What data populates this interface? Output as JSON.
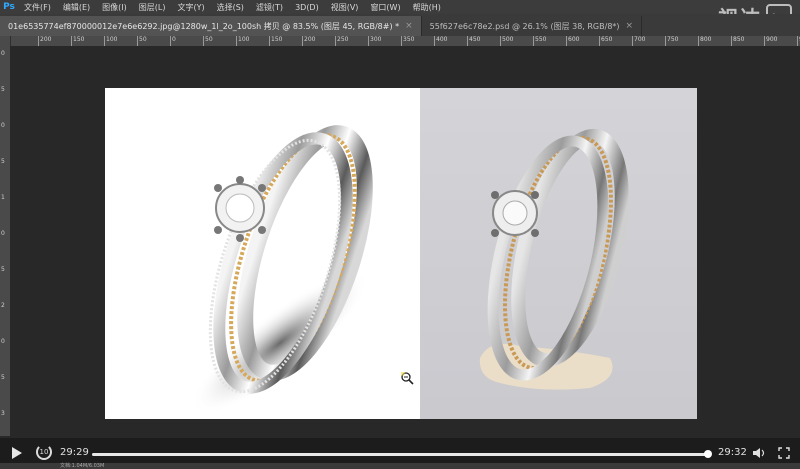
{
  "app": {
    "logo": "Ps"
  },
  "menu": [
    "文件(F)",
    "编辑(E)",
    "图像(I)",
    "图层(L)",
    "文字(Y)",
    "选择(S)",
    "滤镜(T)",
    "3D(D)",
    "视图(V)",
    "窗口(W)",
    "帮助(H)"
  ],
  "watermark": {
    "text": "视达",
    "icon": "play-icon"
  },
  "tabs": [
    {
      "label": "01e6535774ef870000012e7e6e6292.jpg@1280w_1l_2o_100sh 拷贝 @ 83.5% (图层 45, RGB/8#) *",
      "close": "×"
    },
    {
      "label": "55f627e6c78e2.psd @ 26.1% (图层 38, RGB/8*)",
      "close": "×"
    }
  ],
  "ruler": {
    "top_ticks": [
      "200",
      "150",
      "100",
      "50",
      "0",
      "50",
      "100",
      "150",
      "200",
      "250",
      "300",
      "350",
      "400",
      "450",
      "500",
      "550",
      "600",
      "650",
      "700",
      "750",
      "800",
      "850",
      "900",
      "950"
    ],
    "left_ticks": [
      "0",
      "5",
      "0",
      "5",
      "1",
      "0",
      "5",
      "2",
      "0",
      "5",
      "3"
    ]
  },
  "player": {
    "elapsed": "29:29",
    "total": "29:32",
    "progress": 0.998,
    "replay_label": "10"
  },
  "status": {
    "text": "文档:1.04M/6.03M"
  },
  "colors": {
    "accent": "#31a8ff",
    "canvas": "#282828"
  }
}
